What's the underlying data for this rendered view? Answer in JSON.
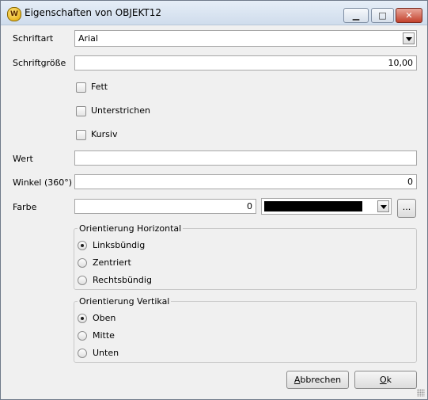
{
  "window": {
    "title": "Eigenschaften von OBJEKT12",
    "icon": "wo-app-icon"
  },
  "titlebar": {
    "minimize": "minimize-icon",
    "maximize": "maximize-icon",
    "close": "close-icon"
  },
  "form": {
    "schriftart": {
      "label": "Schriftart",
      "value": "Arial"
    },
    "schriftgroesse": {
      "label": "Schriftgröße",
      "value": "10,00"
    },
    "fett": {
      "label": "Fett",
      "checked": false
    },
    "unterstrichen": {
      "label": "Unterstrichen",
      "checked": false
    },
    "kursiv": {
      "label": "Kursiv",
      "checked": false
    },
    "wert": {
      "label": "Wert",
      "value": ""
    },
    "winkel": {
      "label": "Winkel (360°)",
      "value": "0"
    },
    "farbe": {
      "label": "Farbe",
      "value": "0",
      "swatch_color": "#000000",
      "more_label": "..."
    }
  },
  "horizontal": {
    "title": "Orientierung Horizontal",
    "options": [
      {
        "label": "Linksbündig",
        "selected": true
      },
      {
        "label": "Zentriert",
        "selected": false
      },
      {
        "label": "Rechtsbündig",
        "selected": false
      }
    ]
  },
  "vertical": {
    "title": "Orientierung Vertikal",
    "options": [
      {
        "label": "Oben",
        "selected": true
      },
      {
        "label": "Mitte",
        "selected": false
      },
      {
        "label": "Unten",
        "selected": false
      }
    ]
  },
  "buttons": {
    "cancel": {
      "access": "A",
      "rest": "bbrechen"
    },
    "ok": {
      "access": "O",
      "rest": "k"
    }
  }
}
